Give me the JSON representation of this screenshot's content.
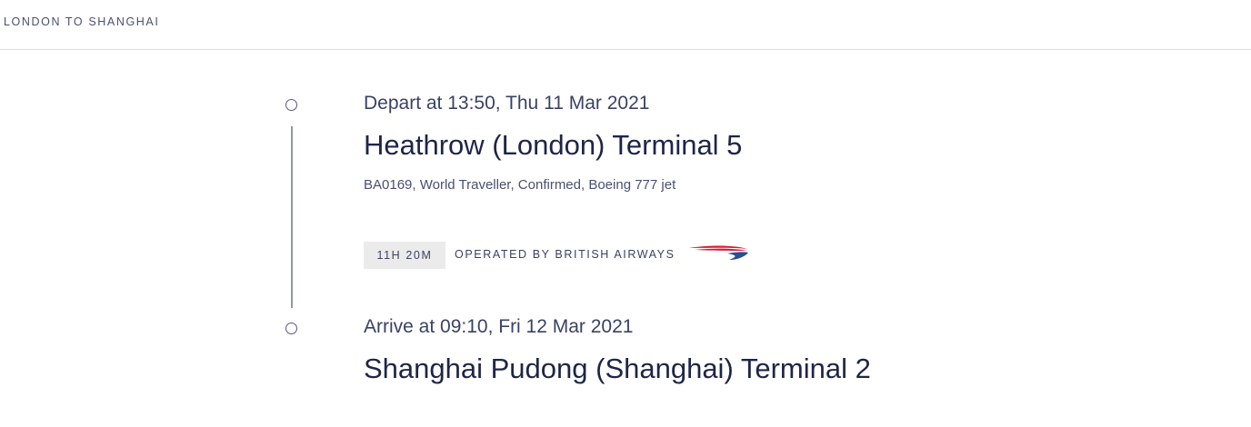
{
  "header": {
    "route_title": "LONDON TO SHANGHAI"
  },
  "segment": {
    "departure": {
      "time_text": "Depart at 13:50, Thu 11 Mar 2021",
      "airport": "Heathrow (London) Terminal 5"
    },
    "flight_info": "BA0169, World Traveller, Confirmed, Boeing 777 jet",
    "duration": "11H 20M",
    "operator": "OPERATED BY BRITISH AIRWAYS",
    "airline_logo_icon": "british-airways-speedmarque-icon",
    "arrival": {
      "time_text": "Arrive at 09:10, Fri 12 Mar 2021",
      "airport": "Shanghai Pudong (Shanghai) Terminal 2"
    }
  },
  "colors": {
    "text_primary": "#1e2548",
    "logo_red": "#d2202f",
    "logo_blue": "#2a4e8f"
  }
}
